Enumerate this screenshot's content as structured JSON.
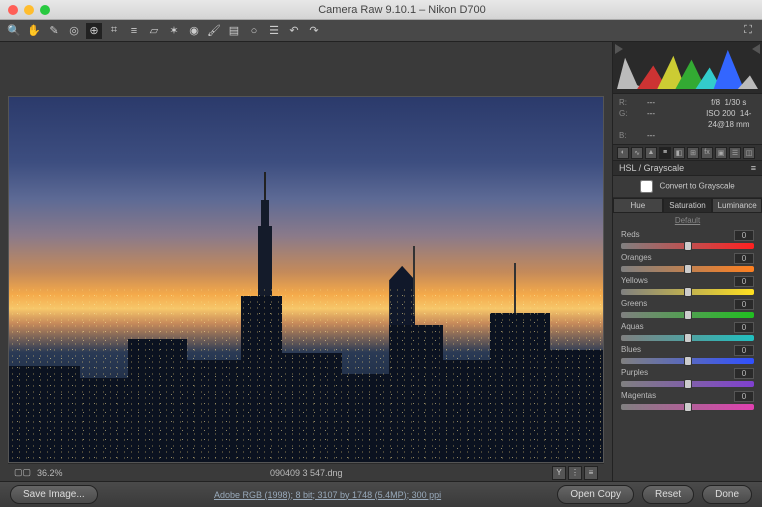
{
  "window": {
    "title": "Camera Raw 9.10.1  –  Nikon D700"
  },
  "status": {
    "zoom": "36.2%",
    "filename": "090409 3 547.dng"
  },
  "footer": {
    "save": "Save Image...",
    "profile": "Adobe RGB (1998); 8 bit; 3107 by 1748 (5.4MP); 300 ppi",
    "open": "Open Copy",
    "reset": "Reset",
    "done": "Done"
  },
  "exif": {
    "r": "R:",
    "g": "G:",
    "b": "B:",
    "rv": "---",
    "gv": "---",
    "bv": "---",
    "aperture": "f/8",
    "shutter": "1/30 s",
    "iso": "ISO 200",
    "lens": "14-24@18 mm"
  },
  "panel": {
    "title": "HSL / Grayscale",
    "convert": "Convert to Grayscale",
    "tabs": {
      "hue": "Hue",
      "sat": "Saturation",
      "lum": "Luminance"
    },
    "default": "Default"
  },
  "sliders": [
    {
      "label": "Reds",
      "value": "0",
      "grad": "g-reds"
    },
    {
      "label": "Oranges",
      "value": "0",
      "grad": "g-oranges"
    },
    {
      "label": "Yellows",
      "value": "0",
      "grad": "g-yellows"
    },
    {
      "label": "Greens",
      "value": "0",
      "grad": "g-greens"
    },
    {
      "label": "Aquas",
      "value": "0",
      "grad": "g-aquas"
    },
    {
      "label": "Blues",
      "value": "0",
      "grad": "g-blues"
    },
    {
      "label": "Purples",
      "value": "0",
      "grad": "g-purples"
    },
    {
      "label": "Magentas",
      "value": "0",
      "grad": "g-magentas"
    }
  ]
}
